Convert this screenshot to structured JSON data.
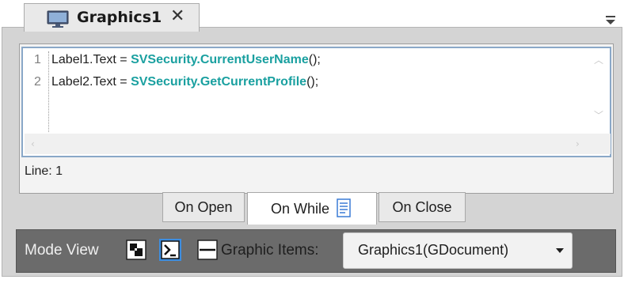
{
  "tab": {
    "title": "Graphics1",
    "close_glyph": "✕",
    "icon": "monitor-icon"
  },
  "editor": {
    "lines": [
      {
        "number": "1",
        "prefix": "Label1.Text = ",
        "call": "SVSecurity.CurrentUserName",
        "suffix": "();"
      },
      {
        "number": "2",
        "prefix": "Label2.Text = ",
        "call": "SVSecurity.GetCurrentProfile",
        "suffix": "();"
      }
    ],
    "status": "Line: 1"
  },
  "event_tabs": [
    {
      "label": "On Open",
      "active": false
    },
    {
      "label": "On While",
      "active": true,
      "icon": "document-icon"
    },
    {
      "label": "On Close",
      "active": false
    }
  ],
  "bottom_bar": {
    "mode_label": "Mode View",
    "graphic_items_label": "Graphic Items:",
    "dropdown_value": "Graphics1(GDocument)"
  },
  "colors": {
    "keyword": "#1aa0a0",
    "bar_bg": "#6b6b6b",
    "panel_bg": "#d4d4d4",
    "selected_mode": "#3c8de0"
  }
}
